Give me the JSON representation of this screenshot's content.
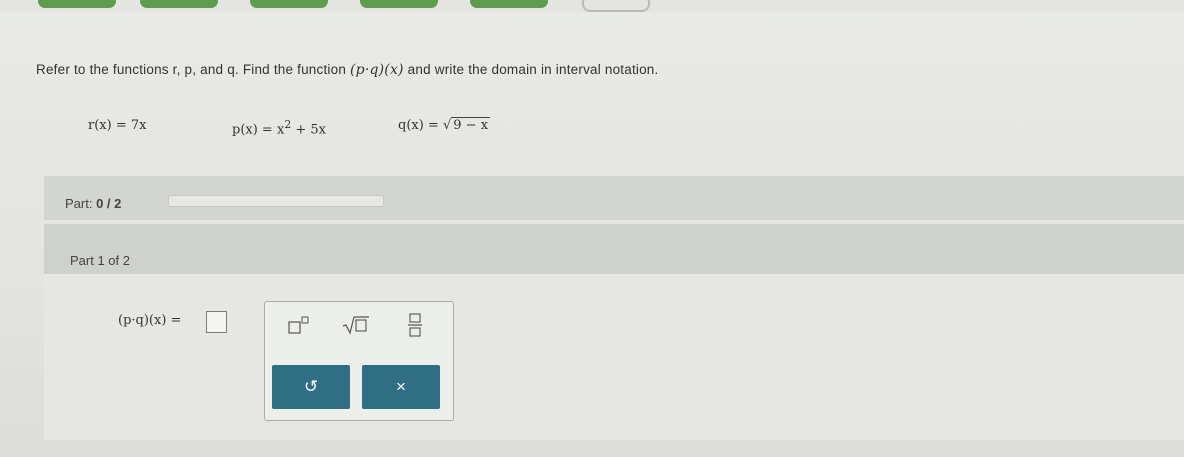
{
  "question": {
    "prefix": "Refer to the functions r, p, and q. Find the function",
    "function_expr": "(p·q)(x)",
    "suffix": "and write the domain in interval notation."
  },
  "functions": {
    "r": {
      "lhs": "r(x) = ",
      "rhs": "7x"
    },
    "p": {
      "lhs": "p(x) = ",
      "base": "x",
      "exponent": "2",
      "tail": " + 5x"
    },
    "q": {
      "lhs": "q(x) = ",
      "radical": "√",
      "radicand": "9 − x"
    }
  },
  "progress": {
    "label": "Part:",
    "count": "0 / 2",
    "fraction": 0
  },
  "part": {
    "header": "Part 1 of 2"
  },
  "answer": {
    "expression": "(p·q)(x) ="
  },
  "toolbar": {
    "reset_symbol": "↺",
    "clear_symbol": "×"
  },
  "colors": {
    "accent_green": "#5e9c4e",
    "button_teal": "#2f6e83"
  }
}
